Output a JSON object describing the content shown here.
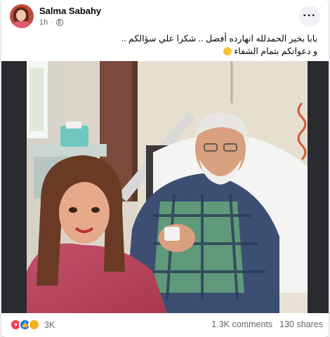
{
  "post": {
    "author": "Salma Sabahy",
    "time": "1h",
    "more_label": "···",
    "caption_line1": "بابا بخير الحمدلله انهارده أفضل .. شكرا علي سؤالكم ..",
    "caption_line2": "و دعواتكم بتمام الشفاء",
    "reaction_count": "3K",
    "comments": "1.3K comments",
    "shares": "130 shares"
  },
  "colors": {
    "brand_blue": "#1877f2",
    "love_red": "#f33e58",
    "care_yellow": "#f7b125",
    "muted_text": "#65676b"
  },
  "icons": [
    "globe-icon",
    "more-options-icon",
    "love-reaction-icon",
    "like-reaction-icon",
    "care-reaction-icon"
  ]
}
